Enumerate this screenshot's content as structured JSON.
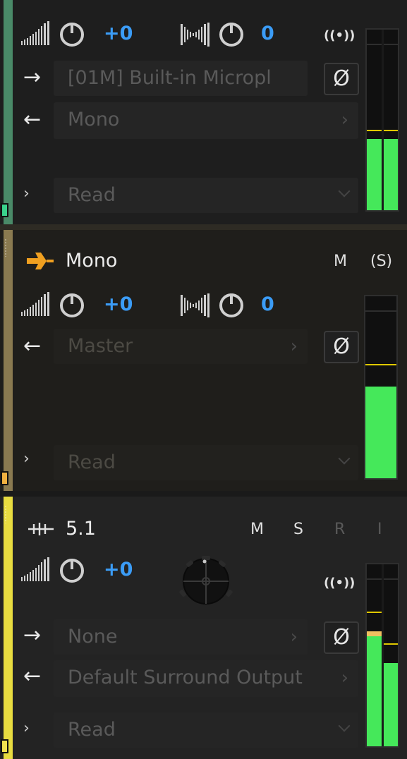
{
  "colors": {
    "accent_blue": "#3b9cf6",
    "meter_green": "#45e85a",
    "peak_yellow": "#e0c800",
    "track1_color": "#4a8a68",
    "track2_color": "#8a7a50",
    "track3_color": "#e8dc40",
    "bus_icon_orange": "#f0a020"
  },
  "track1": {
    "volume_value": "+0",
    "pan_value": "0",
    "input_label": "[01M] Built-in Micropl",
    "output_label": "Mono",
    "automation_label": "Read",
    "phase_symbol": "Ø",
    "radio_symbol": "((•))",
    "meter_fill": [
      0.43,
      0.43
    ],
    "meter_peak": [
      0.48,
      0.48
    ]
  },
  "track2": {
    "title": "Mono",
    "mute_label": "M",
    "solo_label": "(S)",
    "volume_value": "+0",
    "pan_value": "0",
    "output_label": "Master",
    "automation_label": "Read",
    "phase_symbol": "Ø",
    "meter_fill": [
      0.55
    ],
    "meter_peak": [
      0.68
    ]
  },
  "track3": {
    "title": "5.1",
    "mute_label": "M",
    "solo_label": "S",
    "record_label": "R",
    "input_mon_label": "I",
    "volume_value": "+0",
    "input_label": "None",
    "output_label": "Default Surround Output",
    "automation_label": "Read",
    "phase_symbol": "Ø",
    "radio_symbol": "((•))",
    "meter_fill": [
      0.66,
      0.5
    ],
    "meter_peak": [
      0.8,
      0.61
    ]
  },
  "icons": {
    "volume": "volume-bars-icon",
    "pan": "pan-bars-icon",
    "input_arrow": "→",
    "output_arrow": "←",
    "expand": "›",
    "chevron": "›"
  }
}
